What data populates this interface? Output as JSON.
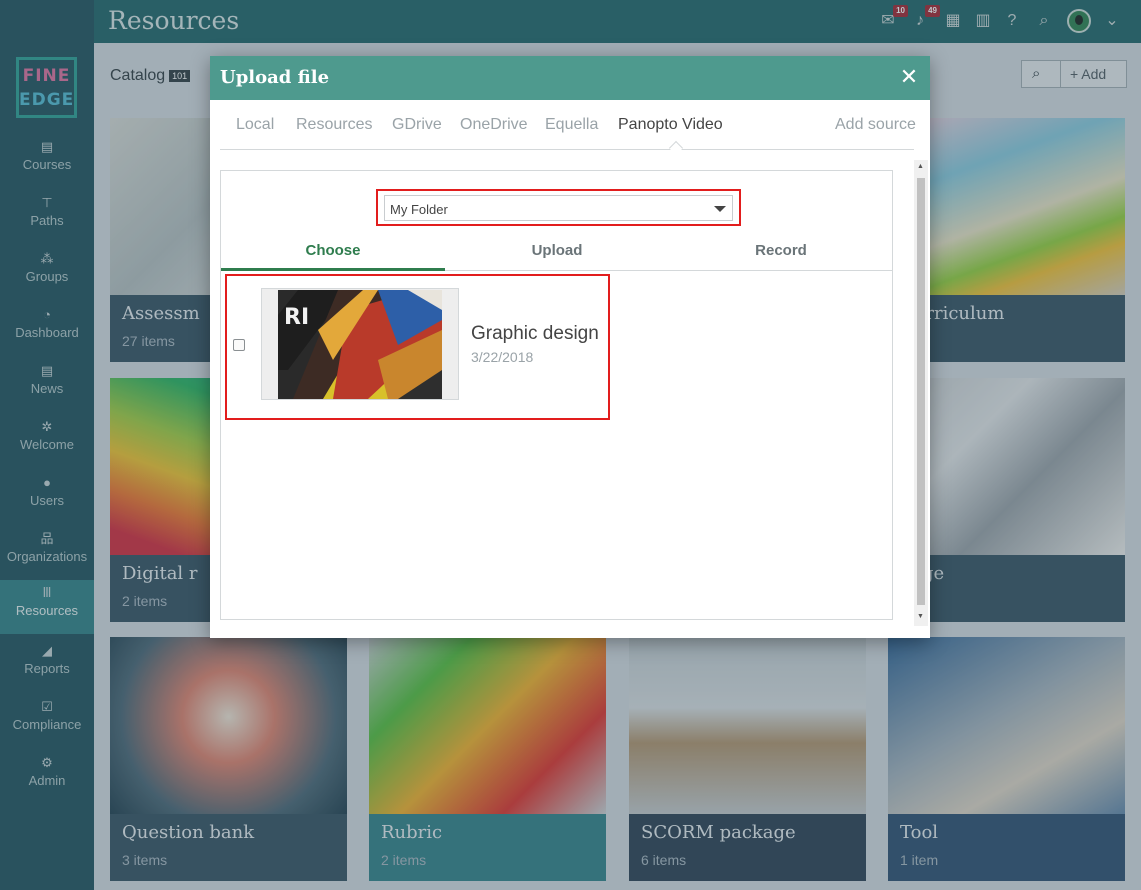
{
  "header": {
    "title": "Resources",
    "messages_badge": "10",
    "notifications_badge": "49"
  },
  "logo": {
    "line1": "FINE",
    "line2": "EDGE"
  },
  "sidebar": {
    "items": [
      {
        "label": "Courses",
        "icon": "book-icon"
      },
      {
        "label": "Paths",
        "icon": "signpost-icon"
      },
      {
        "label": "Groups",
        "icon": "group-icon"
      },
      {
        "label": "Dashboard",
        "icon": "gauge-icon"
      },
      {
        "label": "News",
        "icon": "newspaper-icon"
      },
      {
        "label": "Welcome",
        "icon": "spinner-icon"
      },
      {
        "label": "Users",
        "icon": "user-icon"
      },
      {
        "label": "Organizations",
        "icon": "org-chart-icon"
      },
      {
        "label": "Resources",
        "icon": "library-icon"
      },
      {
        "label": "Reports",
        "icon": "area-chart-icon"
      },
      {
        "label": "Compliance",
        "icon": "check-square-icon"
      },
      {
        "label": "Admin",
        "icon": "gear-icon"
      }
    ]
  },
  "catalog": {
    "label": "Catalog",
    "count": "101",
    "add_label": "Add"
  },
  "cards": [
    {
      "title": "Assessm",
      "count": "27 items"
    },
    {
      "title": "Curriculum",
      "count": "ms"
    },
    {
      "title": "Digital r",
      "count": "2 items"
    },
    {
      "title": "Page",
      "count": "ms"
    },
    {
      "title": "Question bank",
      "count": "3 items"
    },
    {
      "title": "Rubric",
      "count": "2 items"
    },
    {
      "title": "SCORM package",
      "count": "6 items"
    },
    {
      "title": "Tool",
      "count": "1 item"
    }
  ],
  "modal": {
    "title": "Upload file",
    "source_tabs": [
      "Local",
      "Resources",
      "GDrive",
      "OneDrive",
      "Equella",
      "Panopto Video"
    ],
    "add_source": "Add source",
    "folder_value": "My Folder",
    "sub_tabs": [
      "Choose",
      "Upload",
      "Record"
    ],
    "item": {
      "title": "Graphic design",
      "date": "3/22/2018"
    }
  },
  "colors": {
    "sidebar": "#2e5d68",
    "topbar": "#2f6f73",
    "modal_header": "#4e9a8e",
    "active_tab": "#2f7d4e",
    "highlight": "#e21d1d"
  }
}
